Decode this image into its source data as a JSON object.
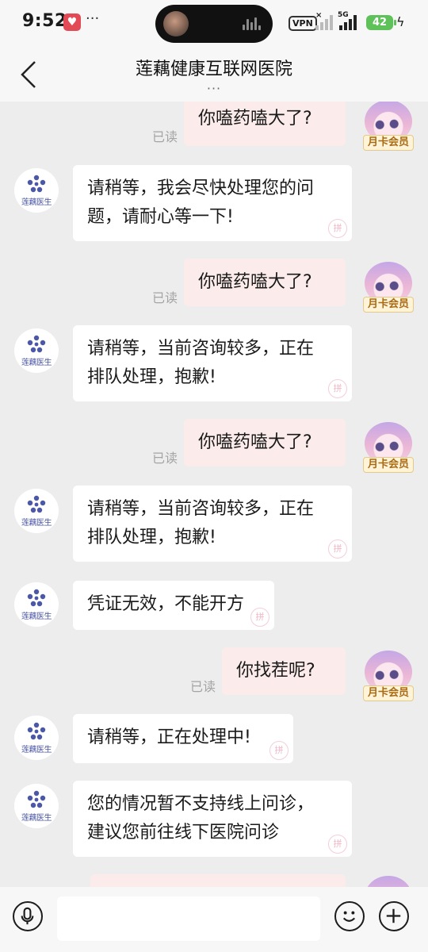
{
  "status_bar": {
    "time": "9:52",
    "dots": "···",
    "vpn": "VPN",
    "network": "5G",
    "signal_x": "×",
    "battery": "42"
  },
  "header": {
    "title": "莲藕健康互联网医院",
    "more": "···",
    "back_icon": "chevron-left-icon"
  },
  "doctor": {
    "avatar_label": "莲藕医生"
  },
  "me": {
    "badge": "月卡会员"
  },
  "messages": [
    {
      "from": "me",
      "text": "你嗑药嗑大了?",
      "read": "已读"
    },
    {
      "from": "doctor",
      "lines": [
        "请稍等，我会尽快处理您的问",
        "题，请耐心等一下!"
      ]
    },
    {
      "from": "me",
      "text": "你嗑药嗑大了?",
      "read": "已读"
    },
    {
      "from": "doctor",
      "lines": [
        "请稍等，当前咨询较多，正在",
        "排队处理，抱歉!"
      ]
    },
    {
      "from": "me",
      "text": "你嗑药嗑大了?",
      "read": "已读"
    },
    {
      "from": "doctor",
      "lines": [
        "请稍等，当前咨询较多，正在",
        "排队处理，抱歉!"
      ]
    },
    {
      "from": "doctor",
      "lines": [
        "凭证无效，不能开方"
      ]
    },
    {
      "from": "me",
      "text": "你找茬呢?",
      "read": "已读"
    },
    {
      "from": "doctor",
      "lines": [
        "请稍等，正在处理中!"
      ]
    },
    {
      "from": "doctor",
      "lines": [
        "您的情况暂不支持线上问诊，",
        "建议您前往线下医院问诊"
      ]
    }
  ],
  "input_bar": {
    "voice_icon": "microphone-icon",
    "emoji_icon": "emoji-icon",
    "plus_icon": "plus-icon",
    "text_value": ""
  }
}
